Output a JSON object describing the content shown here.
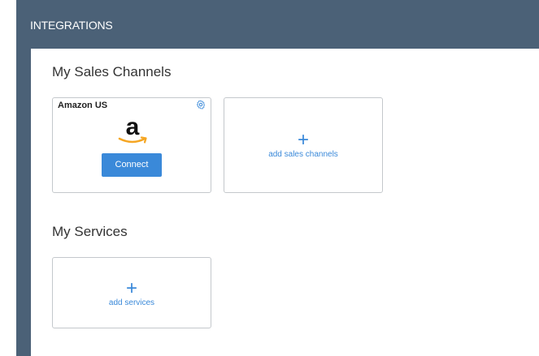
{
  "header": {
    "title": "INTEGRATIONS"
  },
  "sales_channels": {
    "title": "My Sales Channels",
    "channel": {
      "name": "Amazon US",
      "logo_letter": "a",
      "connect_label": "Connect"
    },
    "add_label": "add sales channels"
  },
  "services": {
    "title": "My Services",
    "add_label": "add services"
  },
  "icons": {
    "plus": "+",
    "settings": "gear-icon",
    "logo": "amazon-logo"
  },
  "colors": {
    "header_bg": "#4b6177",
    "accent": "#3a89d9",
    "amazon_smile": "#f5a623"
  }
}
